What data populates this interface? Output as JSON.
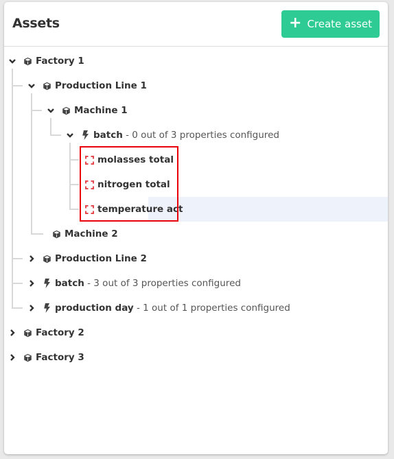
{
  "header": {
    "title": "Assets",
    "create_button_label": "Create asset",
    "create_button_icon": "plus-icon",
    "accent_color": "#2ecc94"
  },
  "tree": [
    {
      "id": "factory-1",
      "name": "Factory 1",
      "icon": "cube-icon",
      "expanded": true,
      "level": 0
    },
    {
      "id": "production-line-1",
      "name": "Production Line 1",
      "icon": "cube-icon",
      "expanded": true,
      "level": 1
    },
    {
      "id": "machine-1",
      "name": "Machine 1",
      "icon": "cube-icon",
      "expanded": true,
      "level": 2
    },
    {
      "id": "batch-1",
      "name": "batch",
      "meta": " - 0 out of 3 properties configured",
      "icon": "bolt-icon",
      "expanded": true,
      "level": 3
    },
    {
      "id": "molasses-total",
      "name": "molasses total",
      "icon": "unconfigured-property-icon",
      "level": 4
    },
    {
      "id": "nitrogen-total",
      "name": "nitrogen total",
      "icon": "unconfigured-property-icon",
      "level": 4
    },
    {
      "id": "temperature-act",
      "name": "temperature act",
      "icon": "unconfigured-property-icon",
      "level": 4,
      "selected": true
    },
    {
      "id": "machine-2",
      "name": "Machine 2",
      "icon": "cube-icon",
      "level": 2
    },
    {
      "id": "production-line-2",
      "name": "Production Line 2",
      "icon": "cube-icon",
      "expanded": false,
      "level": 1
    },
    {
      "id": "batch-2",
      "name": "batch",
      "meta": " - 3 out of 3 properties configured",
      "icon": "bolt-icon",
      "expanded": false,
      "level": 1
    },
    {
      "id": "production-day",
      "name": "production day",
      "meta": " - 1 out of 1 properties configured",
      "icon": "bolt-icon",
      "expanded": false,
      "level": 1
    },
    {
      "id": "factory-2",
      "name": "Factory 2",
      "icon": "cube-icon",
      "expanded": false,
      "level": 0
    },
    {
      "id": "factory-3",
      "name": "Factory 3",
      "icon": "cube-icon",
      "expanded": false,
      "level": 0
    }
  ],
  "highlight_color": "#e8000b",
  "unconfigured_color": "#e5484d"
}
